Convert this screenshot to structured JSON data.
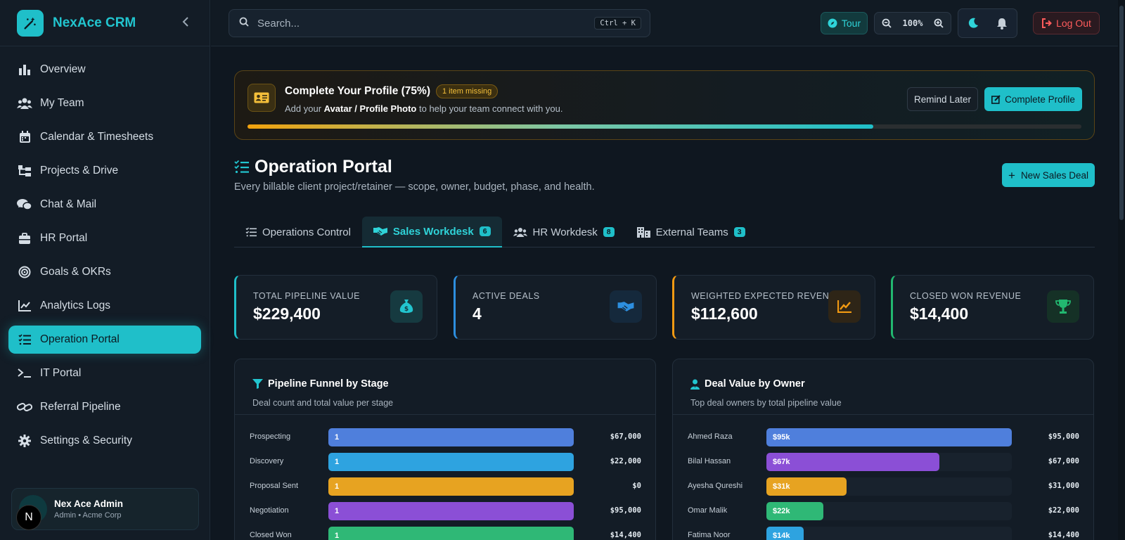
{
  "app": {
    "name": "NexAce CRM",
    "collapse_icon": "chevron-left-icon"
  },
  "sidebar": {
    "items": [
      {
        "label": "Overview",
        "icon": "bar-chart-icon",
        "active": false
      },
      {
        "label": "My Team",
        "icon": "users-icon",
        "active": false
      },
      {
        "label": "Calendar & Timesheets",
        "icon": "calendar-icon",
        "active": false
      },
      {
        "label": "Projects & Drive",
        "icon": "folder-tree-icon",
        "active": false
      },
      {
        "label": "Chat & Mail",
        "icon": "chat-icon",
        "active": false
      },
      {
        "label": "HR Portal",
        "icon": "briefcase-icon",
        "active": false
      },
      {
        "label": "Goals & OKRs",
        "icon": "target-icon",
        "active": false
      },
      {
        "label": "Analytics Logs",
        "icon": "line-chart-icon",
        "active": false
      },
      {
        "label": "Operation Portal",
        "icon": "list-check-icon",
        "active": true
      },
      {
        "label": "IT Portal",
        "icon": "terminal-icon",
        "active": false
      },
      {
        "label": "Referral Pipeline",
        "icon": "link-icon",
        "active": false
      },
      {
        "label": "Settings & Security",
        "icon": "gear-icon",
        "active": false
      }
    ],
    "user": {
      "name": "Nex Ace Admin",
      "role": "Admin • Acme Corp",
      "initial": "N"
    }
  },
  "topbar": {
    "search": {
      "placeholder": "Search...",
      "shortcut": "Ctrl + K"
    },
    "tour_label": "Tour",
    "zoom_value": "100%",
    "logout_label": "Log Out"
  },
  "profile_banner": {
    "title": "Complete Your Profile (75%)",
    "badge": "1 item missing",
    "sub_prefix": "Add your ",
    "sub_item": "Avatar / Profile Photo",
    "sub_suffix": " to help your team connect with you.",
    "progress": 0.75,
    "remind_label": "Remind Later",
    "complete_label": "Complete Profile"
  },
  "page": {
    "title": "Operation Portal",
    "subtitle": "Every billable client project/retainer — scope, owner, budget, phase, and health.",
    "new_deal_label": "New Sales Deal"
  },
  "tabs": [
    {
      "label": "Operations Control",
      "count": null,
      "icon": "list-check-icon",
      "active": false
    },
    {
      "label": "Sales Workdesk",
      "count": "6",
      "icon": "handshake-icon",
      "active": true
    },
    {
      "label": "HR Workdesk",
      "count": "8",
      "icon": "users-icon",
      "active": false
    },
    {
      "label": "External Teams",
      "count": "3",
      "icon": "building-icon",
      "active": false
    }
  ],
  "kpis": [
    {
      "label": "TOTAL PIPELINE VALUE",
      "value": "$229,400",
      "color": "#1fbfc9",
      "icon": "money-bag-icon"
    },
    {
      "label": "ACTIVE DEALS",
      "value": "4",
      "color": "#2d8fe0",
      "icon": "handshake-icon"
    },
    {
      "label": "WEIGHTED EXPECTED REVENUE",
      "value": "$112,600",
      "color": "#f29a12",
      "icon": "trend-up-icon"
    },
    {
      "label": "CLOSED WON REVENUE",
      "value": "$14,400",
      "color": "#22b870",
      "icon": "trophy-icon"
    }
  ],
  "funnel_panel": {
    "title": "Pipeline Funnel by Stage",
    "subtitle": "Deal count and total value per stage",
    "icon": "filter-icon"
  },
  "owner_panel": {
    "title": "Deal Value by Owner",
    "subtitle": "Top deal owners by total pipeline value",
    "icon": "user-tie-icon"
  },
  "chart_data": [
    {
      "type": "bar",
      "orientation": "horizontal",
      "title": "Pipeline Funnel by Stage",
      "categories": [
        "Prospecting",
        "Discovery",
        "Proposal Sent",
        "Negotiation",
        "Closed Won"
      ],
      "counts": [
        1,
        1,
        1,
        1,
        1
      ],
      "value_labels": [
        "$67,000",
        "$22,000",
        "$0",
        "$95,000",
        "$14,400"
      ],
      "values": [
        67000,
        22000,
        0,
        95000,
        14400
      ],
      "colors": [
        "#4f7fdc",
        "#2ea3e0",
        "#e7a321",
        "#8b4fd6",
        "#2fb876"
      ]
    },
    {
      "type": "bar",
      "orientation": "horizontal",
      "title": "Deal Value by Owner",
      "categories": [
        "Ahmed Raza",
        "Bilal Hassan",
        "Ayesha Qureshi",
        "Omar Malik",
        "Fatima Noor"
      ],
      "short_labels": [
        "$95k",
        "$67k",
        "$31k",
        "$22k",
        "$14k"
      ],
      "value_labels": [
        "$95,000",
        "$67,000",
        "$31,000",
        "$22,000",
        "$14,400"
      ],
      "values": [
        95000,
        67000,
        31000,
        22000,
        14400
      ],
      "max": 95000,
      "colors": [
        "#4f7fdc",
        "#8b4fd6",
        "#e7a321",
        "#2fb876",
        "#2ea3e0"
      ]
    }
  ]
}
